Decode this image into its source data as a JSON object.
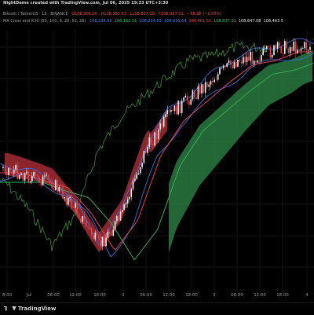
{
  "header": {
    "author_line": "NightDame created with TradingView.com, Jul 06, 2025 19:33 UTC+3:30",
    "symbol": "Bitcoin / TetherUS · 15 · BINANCE",
    "ohlc": {
      "open": "O108,906.00",
      "high": "H108,955.63",
      "low": "L108,837.00",
      "close": "C108,837.01",
      "change": "−68.98 (−0.06%)"
    },
    "indicator_name": "MA Cross and ICHI (50, 100, 9, 26, 52, 26)",
    "indicator_values": [
      {
        "text": "108,234.83",
        "color": "#3b82f6"
      },
      {
        "text": "108,162.51",
        "color": "#22c55e"
      },
      {
        "text": "108,234.83",
        "color": "#3b82f6"
      },
      {
        "text": "108,835.64",
        "color": "#3b82f6"
      },
      {
        "text": "108,461.52",
        "color": "#ef4444"
      },
      {
        "text": "108,837.01",
        "color": "#22c55e"
      },
      {
        "text": "108,647.08",
        "color": "#e5e5e5"
      },
      {
        "text": "108,463.5",
        "color": "#e5e5e5"
      }
    ]
  },
  "colors": {
    "background": "#000000",
    "candle_up": "#f2f2f2",
    "candle_down": "#e0434c",
    "ma_fast": "#e0434c",
    "ma_slow": "#3aaa55",
    "ichi_lines": "#3b6fdf",
    "lagging_span": "#3f8a3a",
    "kumo_bearish": "#b8313a",
    "kumo_bullish": "#2f8a48"
  },
  "footer": {
    "logo": "TradingView"
  },
  "chart_data": {
    "type": "candlestick",
    "symbol": "Bitcoin / TetherUS",
    "interval": "15",
    "x_ticks": [
      "8:00",
      "Jul",
      "06:00",
      "12:00",
      "18:00",
      "2",
      "06:00",
      "12:00",
      "18:00",
      "3",
      "06:00",
      "12:00",
      "18:00",
      "4"
    ],
    "price_path_estimate": [
      {
        "t": "Jul 1 00:00",
        "price": 0.44
      },
      {
        "t": "Jul 1 06:00",
        "price": 0.4
      },
      {
        "t": "Jul 1 12:00",
        "price": 0.37
      },
      {
        "t": "Jul 1 18:00",
        "price": 0.25
      },
      {
        "t": "Jul 2 00:00",
        "price": 0.08
      },
      {
        "t": "Jul 2 06:00",
        "price": 0.22
      },
      {
        "t": "Jul 2 12:00",
        "price": 0.52
      },
      {
        "t": "Jul 2 18:00",
        "price": 0.68
      },
      {
        "t": "Jul 3 00:00",
        "price": 0.77
      },
      {
        "t": "Jul 3 06:00",
        "price": 0.86
      },
      {
        "t": "Jul 3 12:00",
        "price": 0.94
      },
      {
        "t": "Jul 3 18:00",
        "price": 0.96
      },
      {
        "t": "Jul 4 00:00",
        "price": 1.0
      }
    ],
    "price_scale": "relative (0 = lowest, 1 = highest visible price)",
    "last_close": 108837.01,
    "kumo": {
      "bearish_until": "Jul 2 06:00",
      "bullish_after": "Jul 2 06:00"
    }
  }
}
